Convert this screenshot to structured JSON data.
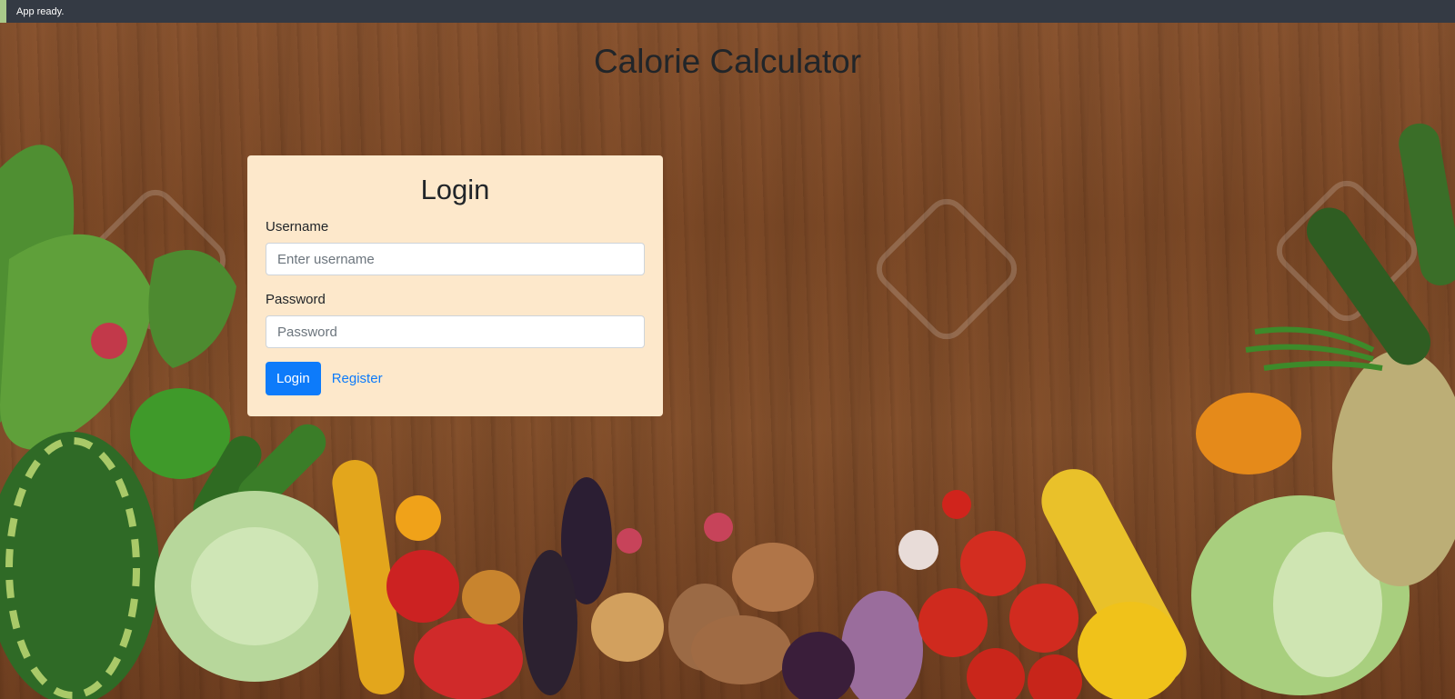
{
  "status": {
    "text": "App ready.",
    "accent_color": "#a9c98a",
    "bg_color": "#343a44"
  },
  "page": {
    "title": "Calorie Calculator"
  },
  "login": {
    "heading": "Login",
    "username_label": "Username",
    "username_placeholder": "Enter username",
    "password_label": "Password",
    "password_placeholder": "Password",
    "submit_label": "Login",
    "register_label": "Register",
    "card_color": "#fde8cb",
    "accent_color": "#0d7bfa"
  }
}
